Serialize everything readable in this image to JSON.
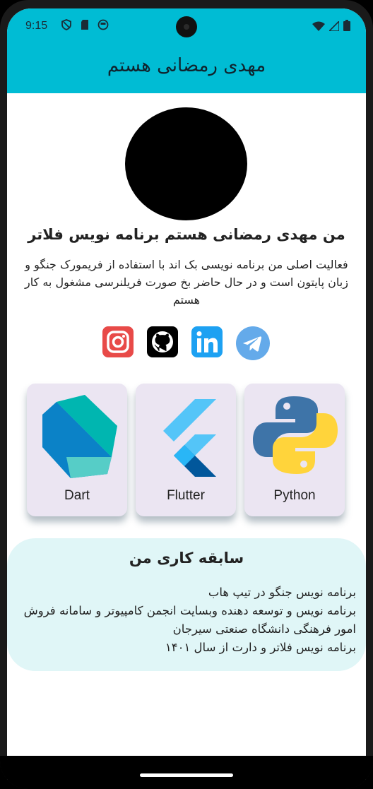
{
  "status_bar": {
    "time": "9:15"
  },
  "app_bar": {
    "title": "مهدی رمضانی هستم"
  },
  "profile": {
    "headline": "من مهدی رمضانی هستم برنامه نویس فلاتر",
    "bio": "فعالیت اصلی من برنامه نویسی بک اند با استفاده از فریمورک جنگو و زبان پایتون است و در حال حاضر بخ صورت فریلنرسی مشغول به کار هستم"
  },
  "socials": [
    {
      "name": "instagram",
      "icon": "instagram-icon",
      "color": "#e84a48"
    },
    {
      "name": "github",
      "icon": "github-icon",
      "color": "#000000"
    },
    {
      "name": "linkedin",
      "icon": "linkedin-icon",
      "color": "#1da1f2"
    },
    {
      "name": "telegram",
      "icon": "telegram-icon",
      "color": "#64aaea"
    }
  ],
  "skills": [
    {
      "label": "Dart",
      "icon": "dart-icon"
    },
    {
      "label": "Flutter",
      "icon": "flutter-icon"
    },
    {
      "label": "Python",
      "icon": "python-icon"
    }
  ],
  "experience": {
    "title": "سابقه کاری من",
    "items": [
      "برنامه نویس جنگو در تیپ هاب",
      "برنامه نویس و توسعه دهنده وبسایت انجمن کامپیوتر و سامانه فروش امور فرهنگی دانشگاه صنعتی سیرجان",
      "برنامه نویس فلاتر و دارت از سال ۱۴۰۱"
    ]
  },
  "colors": {
    "app_bar": "#00bcd4",
    "card": "#ebe5f2",
    "experience_bg": "#e0f6f7"
  }
}
